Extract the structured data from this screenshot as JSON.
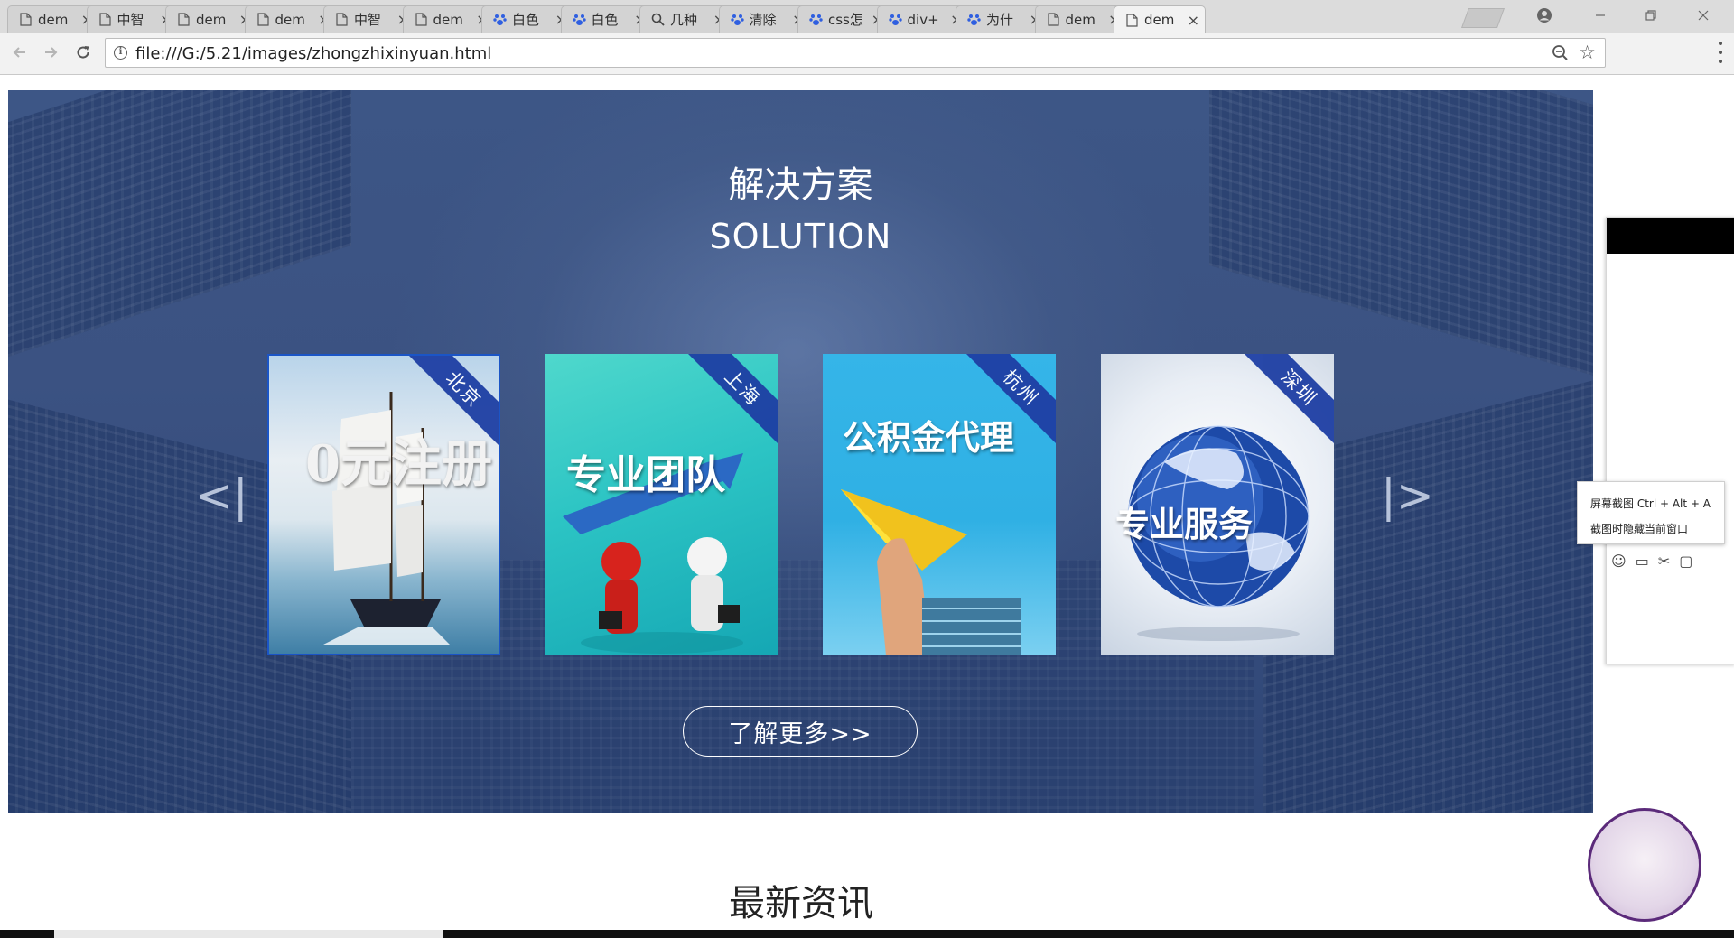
{
  "browser": {
    "tabs": [
      {
        "title": "dem",
        "favicon": "page-icon",
        "active": false
      },
      {
        "title": "中智",
        "favicon": "page-icon",
        "active": false
      },
      {
        "title": "dem",
        "favicon": "page-icon",
        "active": false
      },
      {
        "title": "dem",
        "favicon": "page-icon",
        "active": false
      },
      {
        "title": "中智",
        "favicon": "page-icon",
        "active": false
      },
      {
        "title": "dem",
        "favicon": "page-icon",
        "active": false
      },
      {
        "title": "白色",
        "favicon": "baidu-paw-icon",
        "active": false
      },
      {
        "title": "白色",
        "favicon": "baidu-paw-icon",
        "active": false
      },
      {
        "title": "几种",
        "favicon": "search-icon",
        "active": false
      },
      {
        "title": "清除",
        "favicon": "baidu-paw-icon",
        "active": false
      },
      {
        "title": "css怎",
        "favicon": "baidu-paw-icon",
        "active": false
      },
      {
        "title": "div+",
        "favicon": "baidu-paw-icon",
        "active": false
      },
      {
        "title": "为什",
        "favicon": "baidu-paw-icon",
        "active": false
      },
      {
        "title": "dem",
        "favicon": "page-icon",
        "active": false
      },
      {
        "title": "dem",
        "favicon": "page-icon",
        "active": true
      }
    ],
    "close_glyph": "×",
    "url": "file:///G:/5.21/images/zhongzhixinyuan.html"
  },
  "solution": {
    "title": "解决方案",
    "subtitle": "SOLUTION",
    "prev_arrow": "<|",
    "next_arrow": "|>",
    "cards": [
      {
        "city": "北京",
        "caption": "0元注册",
        "selected": true
      },
      {
        "city": "上海",
        "caption": "专业团队",
        "selected": false
      },
      {
        "city": "杭州",
        "caption": "公积金代理",
        "selected": false
      },
      {
        "city": "深圳",
        "caption": "专业服务",
        "selected": false
      }
    ],
    "more_button": "了解更多>>"
  },
  "news": {
    "title": "最新资讯"
  },
  "screenshot_tool": {
    "tip_line1": "屏幕截图 Ctrl + Alt + A",
    "tip_line2": "截图时隐藏当前窗口"
  },
  "colors": {
    "ribbon": "#1e3fa4",
    "selected_border": "#1b55c6",
    "banner_bg": "#3b5282"
  }
}
